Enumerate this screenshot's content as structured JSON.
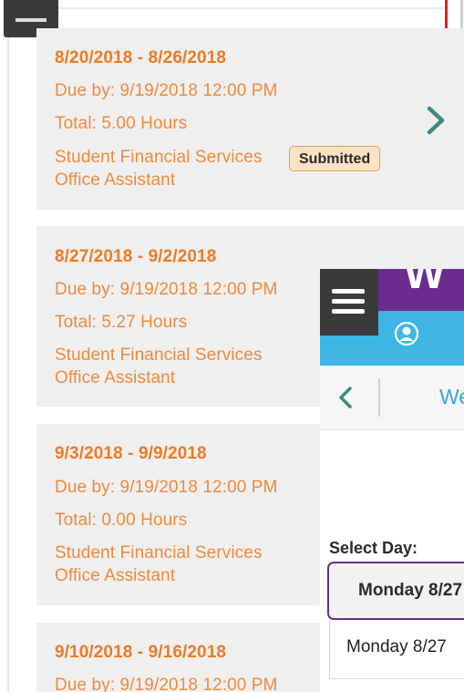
{
  "timesheets": [
    {
      "range": "8/20/2018 - 8/26/2018",
      "due": "Due by: 9/19/2018 12:00 PM",
      "total": "Total: 5.00 Hours",
      "dept": "Student Financial Services",
      "position": "Office Assistant",
      "status": "Submitted"
    },
    {
      "range": "8/27/2018 - 9/2/2018",
      "due": "Due by: 9/19/2018 12:00 PM",
      "total": "Total: 5.27 Hours",
      "dept": "Student Financial Services",
      "position": "Office Assistant"
    },
    {
      "range": "9/3/2018 - 9/9/2018",
      "due": "Due by: 9/19/2018 12:00 PM",
      "total": "Total: 0.00 Hours",
      "dept": "Student Financial Services",
      "position": "Office Assistant"
    },
    {
      "range": "9/10/2018 - 9/16/2018",
      "due": "Due by: 9/19/2018 12:00 PM"
    }
  ],
  "overlay": {
    "brand_text": "W",
    "nav_title_partial": "We",
    "select_day_label": "Select Day:",
    "selected_day": "Monday 8/27",
    "option_day": "Monday 8/27"
  },
  "icons": {
    "menu": "hamburger-menu-icon",
    "user": "user-icon",
    "back": "chevron-left-icon",
    "forward": "chevron-right-icon"
  },
  "colors": {
    "accent_orange": "#ee7b22",
    "badge_bg": "#fde1c1",
    "purple": "#6a2c8e",
    "blue": "#3db6e4",
    "teal_chevron": "#3d8a82",
    "highlight_red": "#e0231c"
  }
}
